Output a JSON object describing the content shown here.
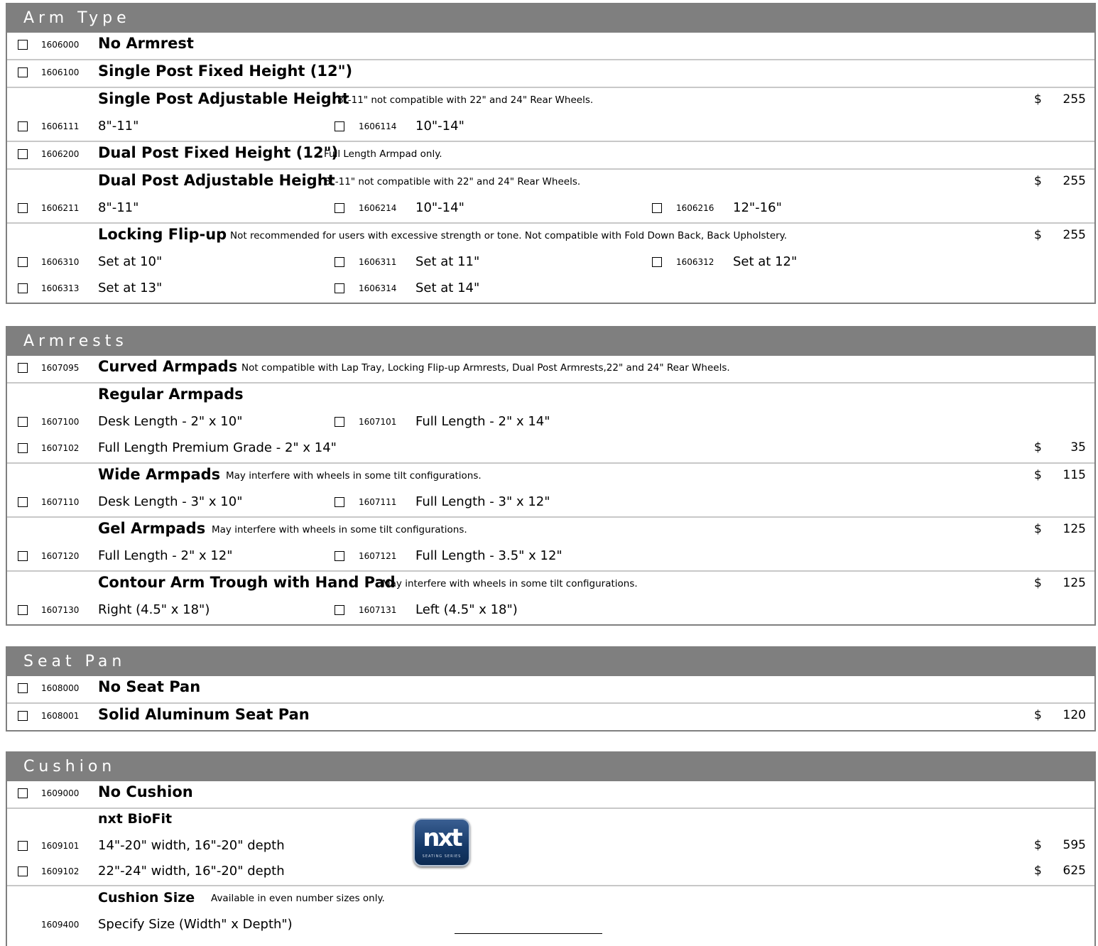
{
  "arm_type": {
    "header": "Arm Type",
    "no_armrest": {
      "code": "1606000",
      "label": "No Armrest"
    },
    "single_fixed": {
      "code": "1606100",
      "label": "Single Post Fixed Height (12\")"
    },
    "single_adjustable": {
      "title": "Single Post Adjustable Height",
      "note": "8\"-11\" not compatible with 22\" and 24\" Rear Wheels.",
      "dollar": "$",
      "price": "255",
      "options": [
        {
          "code": "1606111",
          "label": "8\"-11\""
        },
        {
          "code": "1606114",
          "label": "10\"-14\""
        }
      ]
    },
    "dual_fixed": {
      "code": "1606200",
      "label": "Dual Post Fixed Height (12\")",
      "note": "Full Length Armpad only."
    },
    "dual_adjustable": {
      "title": "Dual Post Adjustable Height",
      "note": "8\"-11\" not compatible with 22\" and 24\" Rear Wheels.",
      "dollar": "$",
      "price": "255",
      "options": [
        {
          "code": "1606211",
          "label": "8\"-11\""
        },
        {
          "code": "1606214",
          "label": "10\"-14\""
        },
        {
          "code": "1606216",
          "label": "12\"-16\""
        }
      ]
    },
    "flip_up": {
      "title": "Locking Flip-up",
      "note": "Not recommended for users with excessive strength or tone. Not compatible with Fold Down Back, Back Upholstery.",
      "dollar": "$",
      "price": "255",
      "options": [
        {
          "code": "1606310",
          "label": "Set at 10\""
        },
        {
          "code": "1606311",
          "label": "Set at 11\""
        },
        {
          "code": "1606312",
          "label": "Set at 12\""
        },
        {
          "code": "1606313",
          "label": "Set at 13\""
        },
        {
          "code": "1606314",
          "label": "Set at 14\""
        }
      ]
    }
  },
  "armrests": {
    "header": "Armrests",
    "curved": {
      "code": "1607095",
      "label": "Curved Armpads",
      "note": "Not compatible with Lap Tray, Locking Flip-up Armrests, Dual Post Armrests,22\" and 24\" Rear Wheels."
    },
    "regular": {
      "title": "Regular Armpads",
      "options": [
        {
          "code": "1607100",
          "label": "Desk Length - 2\" x 10\""
        },
        {
          "code": "1607101",
          "label": "Full Length - 2\" x 14\""
        },
        {
          "code": "1607102",
          "label": "Full Length Premium Grade - 2\" x 14\""
        }
      ],
      "dollar": "$",
      "premium_price": "35"
    },
    "wide": {
      "title": "Wide Armpads",
      "note": "May interfere with wheels in some tilt configurations.",
      "dollar": "$",
      "price": "115",
      "options": [
        {
          "code": "1607110",
          "label": "Desk Length - 3\" x 10\""
        },
        {
          "code": "1607111",
          "label": "Full Length - 3\" x 12\""
        }
      ]
    },
    "gel": {
      "title": "Gel Armpads",
      "note": "May interfere with wheels in some tilt configurations.",
      "dollar": "$",
      "price": "125",
      "options": [
        {
          "code": "1607120",
          "label": "Full Length - 2\" x 12\""
        },
        {
          "code": "1607121",
          "label": "Full Length - 3.5\" x 12\""
        }
      ]
    },
    "contour": {
      "title": "Contour Arm Trough with Hand Pad",
      "note": "May interfere with wheels in some tilt configurations.",
      "dollar": "$",
      "price": "125",
      "options": [
        {
          "code": "1607130",
          "label": "Right (4.5\" x 18\")"
        },
        {
          "code": "1607131",
          "label": "Left (4.5\" x 18\")"
        }
      ]
    }
  },
  "seat_pan": {
    "header": "Seat Pan",
    "none": {
      "code": "1608000",
      "label": "No Seat Pan"
    },
    "solid": {
      "code": "1608001",
      "label": "Solid Aluminum Seat Pan",
      "dollar": "$",
      "price": "120"
    }
  },
  "cushion": {
    "header": "Cushion",
    "none": {
      "code": "1609000",
      "label": "No Cushion"
    },
    "biofit": {
      "title": "nxt BioFit",
      "logo_text": "nxt",
      "logo_sub": "SEATING SERIES",
      "options": [
        {
          "code": "1609101",
          "label": "14\"-20\" width, 16\"-20\" depth",
          "dollar": "$",
          "price": "595"
        },
        {
          "code": "1609102",
          "label": "22\"-24\" width, 16\"-20\" depth",
          "dollar": "$",
          "price": "625"
        }
      ]
    },
    "size": {
      "title": "Cushion Size",
      "note": "Available in even number sizes only.",
      "code": "1609400",
      "label": "Specify Size (Width\" x Depth\")"
    }
  }
}
